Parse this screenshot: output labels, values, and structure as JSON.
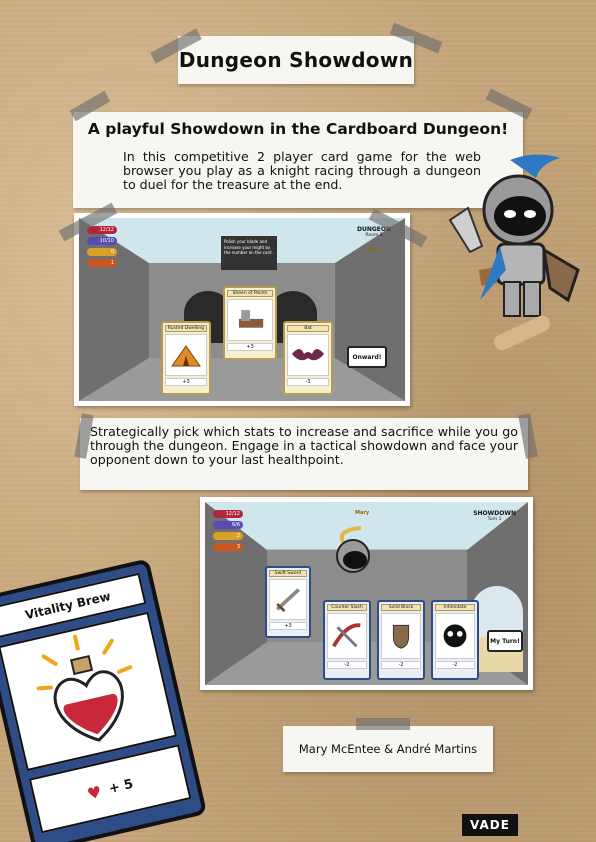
{
  "title": "Dungeon Showdown",
  "intro": {
    "heading": "A playful Showdown in the Cardboard Dungeon!",
    "body": "In this competitive 2 player card game for the web browser you play as a knight racing through a dungeon to duel for the treasure at the end."
  },
  "middle_text": "Strategically pick which stats to increase and sacrifice while you go through the dungeon. Engage in a tactical showdown and face your opponent down to your last healthpoint.",
  "screenshot_dungeon": {
    "header": "DUNGEON",
    "room": "Room 3",
    "player": "Mary",
    "hud": [
      "12/12",
      "10/10",
      "0",
      "1"
    ],
    "flavor_text": "Polish your blade and increase your might by the number on the card.",
    "cards": [
      {
        "name": "Rusted Dwelling",
        "stat": "+3"
      },
      {
        "name": "Sheen of Points",
        "stat": "+3"
      },
      {
        "name": "Bat",
        "stat": "-3"
      }
    ],
    "button": "Onward!"
  },
  "screenshot_showdown": {
    "header": "SHOWDOWN",
    "turn": "Turn 1",
    "player": "Mary",
    "hud": [
      "12/12",
      "6/6",
      "2",
      "3"
    ],
    "cards": [
      {
        "name": "Swift Sword",
        "stat": "+3"
      },
      {
        "name": "Counter Slash",
        "stat": "-2"
      },
      {
        "name": "Solid Block",
        "stat": "-2"
      },
      {
        "name": "Intimidate",
        "stat": "-2"
      }
    ],
    "button": "My Turn!"
  },
  "big_card": {
    "name": "Vitality Brew",
    "stat": "+ 5"
  },
  "credits": "Mary McEntee & André Martins",
  "logo": "VADE",
  "colors": {
    "cardboard": "#c6a67b",
    "panel": "#f7f6f2",
    "card_blue": "#2e4d86",
    "heart": "#c8283a"
  }
}
